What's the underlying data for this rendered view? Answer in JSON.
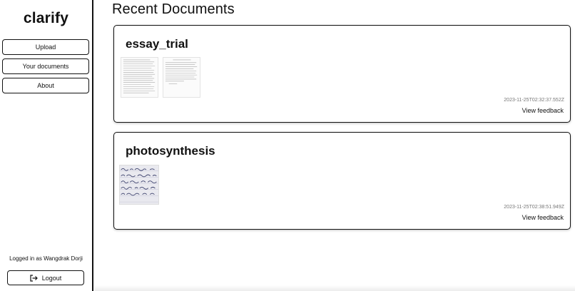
{
  "sidebar": {
    "brand": "clarify",
    "nav": {
      "upload": "Upload",
      "documents": "Your documents",
      "about": "About"
    },
    "logged_in_text": "Logged in as Wangdrak Dorji",
    "logout_label": "Logout",
    "logout_icon": "logout-icon"
  },
  "main": {
    "title": "Recent Documents",
    "documents": [
      {
        "title": "essay_trial",
        "timestamp": "2023-11-25T02:32:37.552Z",
        "action": "View feedback",
        "thumbnail": "typed-pages"
      },
      {
        "title": "photosynthesis",
        "timestamp": "2023-11-25T02:38:51.949Z",
        "action": "View feedback",
        "thumbnail": "handwritten-note"
      }
    ]
  }
}
